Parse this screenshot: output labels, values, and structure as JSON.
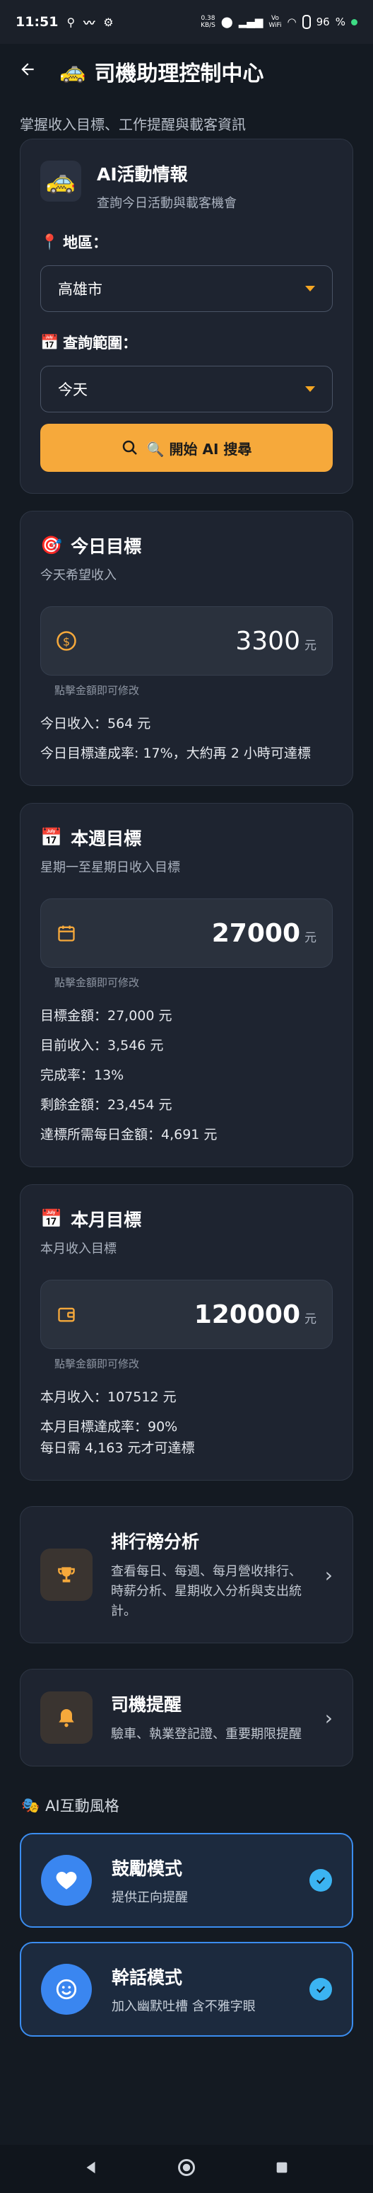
{
  "status": {
    "time": "11:51",
    "net_speed_top": "0.38",
    "net_speed_bottom": "KB/S",
    "wifi_label_top": "Vo",
    "wifi_label_bottom": "WiFi",
    "battery": "96"
  },
  "appbar": {
    "title": "司機助理控制中心",
    "title_icon": "taxi-icon"
  },
  "subtitle": "掌握收入目標、工作提醒與載客資訊",
  "ai_card": {
    "title": "AI活動情報",
    "subtitle": "查詢今日活動與載客機會",
    "region_label": "地區：",
    "region_value": "高雄市",
    "range_label": "查詢範圍：",
    "range_value": "今天",
    "search_button": "🔍 開始 AI 搜尋"
  },
  "daily": {
    "title": "今日目標",
    "subtitle": "今天希望收入",
    "amount": "3300",
    "unit": "元",
    "hint": "點擊金額即可修改",
    "income_line": "今日收入：564 元",
    "rate_line": "今日目標達成率: 17%，大約再 2 小時可達標"
  },
  "weekly": {
    "title": "本週目標",
    "subtitle": "星期一至星期日收入目標",
    "amount": "27000",
    "unit": "元",
    "hint": "點擊金額即可修改",
    "lines": [
      "目標金額：27,000 元",
      "目前收入：3,546 元",
      "完成率：13%",
      "剩餘金額：23,454 元",
      "達標所需每日金額：4,691 元"
    ]
  },
  "monthly": {
    "title": "本月目標",
    "subtitle": "本月收入目標",
    "amount": "120000",
    "unit": "元",
    "hint": "點擊金額即可修改",
    "income_line": "本月收入：107512 元",
    "rate_line": "本月目標達成率：90%",
    "daily_need_line": "每日需 4,163 元才可達標"
  },
  "ranking": {
    "title": "排行榜分析",
    "desc": "查看每日、每週、每月營收排行、時薪分析、星期收入分析與支出統計。"
  },
  "reminder": {
    "title": "司機提醒",
    "desc": "驗車、執業登記證、重要期限提醒"
  },
  "ai_style": {
    "label": "AI互動風格",
    "modes": [
      {
        "title": "鼓勵模式",
        "desc": "提供正向提醒"
      },
      {
        "title": "幹話模式",
        "desc": "加入幽默吐槽 含不雅字眼"
      }
    ]
  },
  "colors": {
    "accent_orange": "#f6a93b",
    "selected_blue": "#3b8df0",
    "background": "#141a22",
    "card": "#1e2430"
  }
}
